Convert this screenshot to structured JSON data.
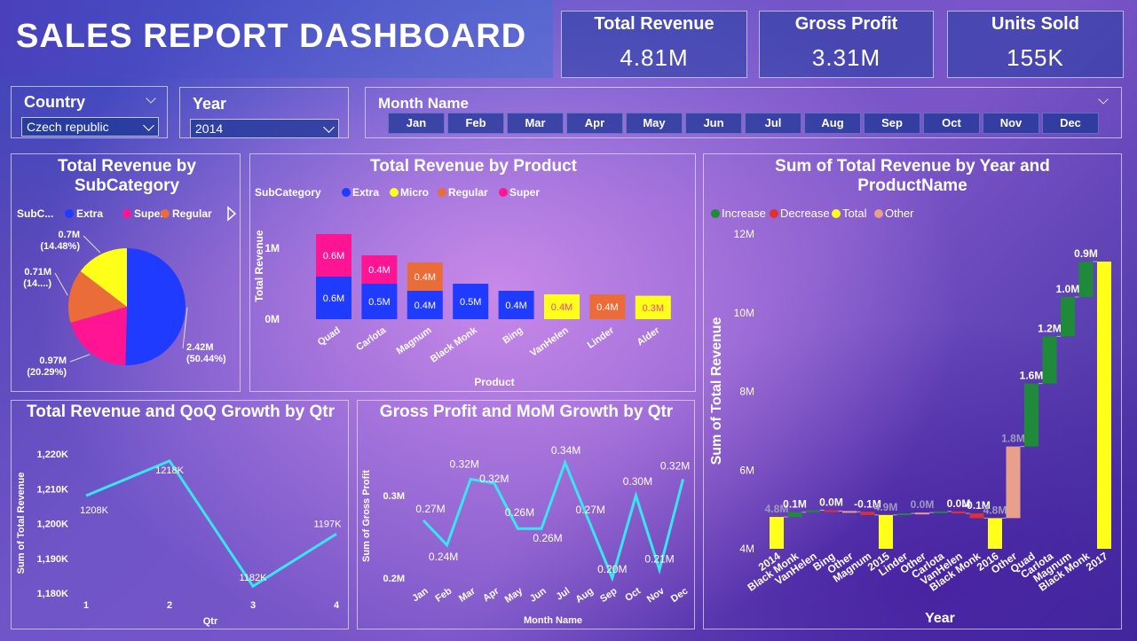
{
  "header": {
    "title": "SALES REPORT DASHBOARD"
  },
  "kpis": [
    {
      "label": "Total Revenue",
      "value": "4.81M"
    },
    {
      "label": "Gross Profit",
      "value": "3.31M"
    },
    {
      "label": "Units Sold",
      "value": "155K"
    }
  ],
  "filters": {
    "country": {
      "label": "Country",
      "value": "Czech republic"
    },
    "year": {
      "label": "Year",
      "value": "2014"
    },
    "month": {
      "label": "Month Name",
      "options": [
        "Jan",
        "Feb",
        "Mar",
        "Apr",
        "May",
        "Jun",
        "Jul",
        "Aug",
        "Sep",
        "Oct",
        "Nov",
        "Dec"
      ]
    }
  },
  "colors": {
    "extra": "#1f3bff",
    "super": "#ff1493",
    "regular": "#ea6c38",
    "micro": "#ffff1a",
    "line": "#38e6f0",
    "increase": "#1e8a3a",
    "decrease": "#e03030",
    "total": "#ffff1a",
    "other": "#e8a08c"
  },
  "chart_data": [
    {
      "type": "pie",
      "title": "Total Revenue by SubCategory",
      "legend_title": "SubC...",
      "legend": [
        "Extra",
        "Super",
        "Regular"
      ],
      "slices": [
        {
          "name": "Extra",
          "value": 2.42,
          "label": "2.42M",
          "pct": "(50.44%)"
        },
        {
          "name": "Super",
          "value": 0.97,
          "label": "0.97M",
          "pct": "(20.29%)"
        },
        {
          "name": "Regular",
          "value": 0.71,
          "label": "0.71M",
          "pct": "(14....)"
        },
        {
          "name": "Micro",
          "value": 0.7,
          "label": "0.7M",
          "pct": "(14.48%)"
        }
      ]
    },
    {
      "type": "bar",
      "title": "Total Revenue by Product",
      "legend_title": "SubCategory",
      "legend": [
        "Extra",
        "Micro",
        "Regular",
        "Super"
      ],
      "xlabel": "Product",
      "ylabel": "Total Revenue",
      "yticks": [
        "0M",
        "1M"
      ],
      "ylim": [
        0,
        1.2
      ],
      "categories": [
        "Quad",
        "Carlota",
        "Magnum",
        "Black Monk",
        "Bing",
        "VanHelen",
        "Linder",
        "Alder"
      ],
      "stacks": [
        [
          {
            "series": "Extra",
            "value": 0.6,
            "label": "0.6M"
          },
          {
            "series": "Super",
            "value": 0.6,
            "label": "0.6M"
          }
        ],
        [
          {
            "series": "Extra",
            "value": 0.5,
            "label": "0.5M"
          },
          {
            "series": "Super",
            "value": 0.4,
            "label": "0.4M"
          }
        ],
        [
          {
            "series": "Extra",
            "value": 0.4,
            "label": "0.4M"
          },
          {
            "series": "Regular",
            "value": 0.4,
            "label": "0.4M"
          }
        ],
        [
          {
            "series": "Extra",
            "value": 0.5,
            "label": "0.5M"
          }
        ],
        [
          {
            "series": "Extra",
            "value": 0.4,
            "label": "0.4M"
          }
        ],
        [
          {
            "series": "Micro",
            "value": 0.35,
            "label": "0.4M"
          }
        ],
        [
          {
            "series": "Regular",
            "value": 0.35,
            "label": "0.4M"
          }
        ],
        [
          {
            "series": "Micro",
            "value": 0.33,
            "label": "0.3M"
          }
        ]
      ]
    },
    {
      "type": "line",
      "title": "Total Revenue and QoQ Growth by Qtr",
      "xlabel": "Qtr",
      "ylabel": "Sum of Total Revenue",
      "x": [
        "1",
        "2",
        "3",
        "4"
      ],
      "values": [
        1208,
        1218,
        1182,
        1197
      ],
      "labels": [
        "1208K",
        "1218K",
        "1182K",
        "1197K"
      ],
      "yticks": [
        "1,180K",
        "1,190K",
        "1,200K",
        "1,210K",
        "1,220K"
      ],
      "ylim": [
        1180,
        1220
      ]
    },
    {
      "type": "line",
      "title": "Gross Profit and MoM Growth by Qtr",
      "xlabel": "Month Name",
      "ylabel": "Sum of Gross Profit",
      "x": [
        "Jan",
        "Feb",
        "Mar",
        "Apr",
        "May",
        "Jun",
        "Jul",
        "Aug",
        "Sep",
        "Oct",
        "Nov",
        "Dec"
      ],
      "values": [
        0.27,
        0.24,
        0.32,
        0.315,
        0.26,
        0.26,
        0.34,
        0.27,
        0.2,
        0.3,
        0.21,
        0.32
      ],
      "labels": [
        "0.27M",
        "0.24M",
        "0.32M",
        "0.32M",
        "0.26M",
        "0.26M",
        "0.34M",
        "0.27M",
        "0.20M",
        "0.30M",
        "0.21M",
        "0.32M"
      ],
      "yticks": [
        "0.2M",
        "0.3M"
      ],
      "ylim": [
        0.2,
        0.3
      ]
    },
    {
      "type": "waterfall",
      "title": "Sum of Total Revenue by Year and ProductName",
      "legend": [
        "Increase",
        "Decrease",
        "Total",
        "Other"
      ],
      "xlabel": "Year",
      "ylabel": "Sum of Total Revenue",
      "yticks": [
        "4M",
        "6M",
        "8M",
        "10M",
        "12M"
      ],
      "ylim": [
        4,
        12
      ],
      "steps": [
        {
          "name": "2014",
          "kind": "total",
          "start": 0,
          "end": 4.81,
          "label": "4.8M"
        },
        {
          "name": "Black Monk",
          "kind": "increase",
          "start": 4.81,
          "end": 4.93,
          "label": "0.1M"
        },
        {
          "name": "VanHelen",
          "kind": "increase",
          "start": 4.93,
          "end": 4.98,
          "label": ""
        },
        {
          "name": "Bing",
          "kind": "decrease",
          "start": 4.98,
          "end": 4.96,
          "label": "0.0M"
        },
        {
          "name": "Other",
          "kind": "other",
          "start": 4.96,
          "end": 4.94,
          "label": ""
        },
        {
          "name": "Magnum",
          "kind": "decrease",
          "start": 4.94,
          "end": 4.86,
          "label": "-0.1M"
        },
        {
          "name": "2015",
          "kind": "total",
          "start": 0,
          "end": 4.86,
          "label": "4.9M"
        },
        {
          "name": "Linder",
          "kind": "increase",
          "start": 4.86,
          "end": 4.9,
          "label": ""
        },
        {
          "name": "Other",
          "kind": "other",
          "start": 4.9,
          "end": 4.92,
          "label": "0.0M"
        },
        {
          "name": "Carlota",
          "kind": "increase",
          "start": 4.92,
          "end": 4.95,
          "label": ""
        },
        {
          "name": "VanHelen",
          "kind": "decrease",
          "start": 4.95,
          "end": 4.9,
          "label": "0.0M"
        },
        {
          "name": "Black Monk",
          "kind": "decrease",
          "start": 4.9,
          "end": 4.78,
          "label": "-0.1M"
        },
        {
          "name": "2016",
          "kind": "total",
          "start": 0,
          "end": 4.78,
          "label": "4.8M"
        },
        {
          "name": "Other",
          "kind": "other",
          "start": 4.78,
          "end": 6.6,
          "label": "1.8M"
        },
        {
          "name": "Quad",
          "kind": "increase",
          "start": 6.6,
          "end": 8.2,
          "label": "1.6M"
        },
        {
          "name": "Carlota",
          "kind": "increase",
          "start": 8.2,
          "end": 9.4,
          "label": "1.2M"
        },
        {
          "name": "Magnum",
          "kind": "increase",
          "start": 9.4,
          "end": 10.4,
          "label": "1.0M"
        },
        {
          "name": "Black Monk",
          "kind": "increase",
          "start": 10.4,
          "end": 11.3,
          "label": "0.9M"
        },
        {
          "name": "2017",
          "kind": "total",
          "start": 0,
          "end": 11.3,
          "label": ""
        }
      ]
    }
  ]
}
